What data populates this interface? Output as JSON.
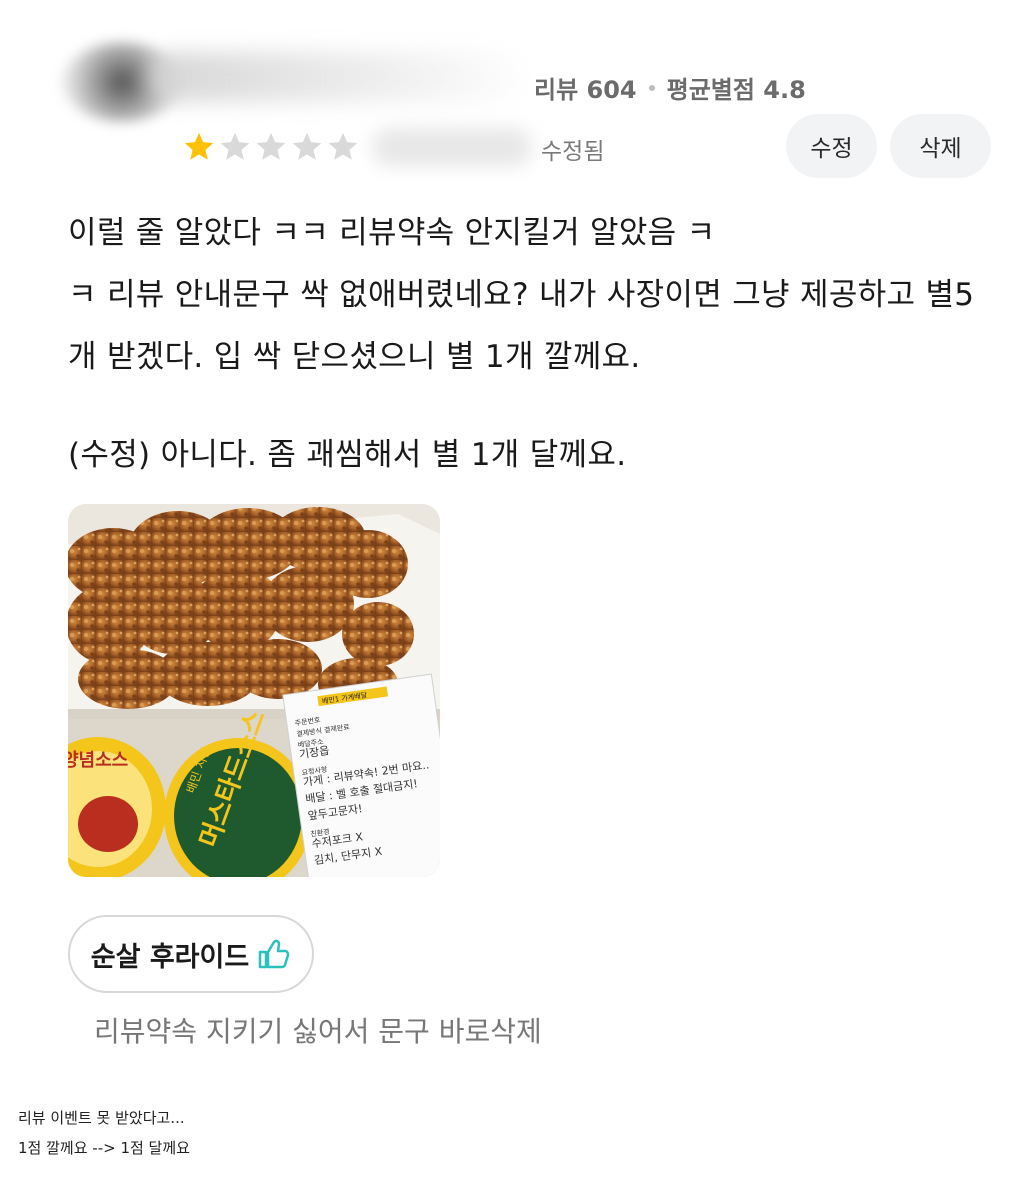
{
  "review": {
    "stats": {
      "review_count": "리뷰 604",
      "average_rating": "평균별점 4.8"
    },
    "rating": 1,
    "max_rating": 5,
    "edited_label": "수정됨",
    "actions": {
      "edit_label": "수정",
      "delete_label": "삭제"
    },
    "body_lines": [
      "이럴 줄 알았다 ㅋㅋ 리뷰약속 안지킬거 알았음 ㅋ",
      "ㅋ 리뷰 안내문구 싹 없애버렸네요? 내가 사장이면 그냥 제공하고 별5",
      "개 받겠다. 입 싹 닫으셨으니 별 1개 깔께요."
    ],
    "edit_note": "(수정) 아니다. 좀 괘씸해서 별 1개 달께요.",
    "photo_receipt": {
      "header": "배민1 가게배달",
      "lines": [
        "주문번호",
        "결제방식 결제완료",
        "배달주소",
        "기장읍",
        "요청사항",
        "가게 : 리뷰약속! 2번 마요..",
        "배달 : 벨 호출 절대금지!",
        "앞두고문자!",
        "친환경",
        "수저포크 X",
        "김치, 단무지 X"
      ]
    },
    "photo_sauce_label": "머스타드소스",
    "photo_sauce_brand": "배민 치킨",
    "photo_left_sauce": "양념소스",
    "menu_item": {
      "label": "순살 후라이드",
      "icon": "thumbs-up-icon"
    },
    "owner_note": "리뷰약속 지키기 싫어서 문구 바로삭제",
    "colors": {
      "star_filled": "#ffc107",
      "star_empty": "#d9d9d9",
      "thumb": "#2ac1bc"
    }
  },
  "captions": [
    "리뷰 이벤트 못 받았다고...",
    "1점 깔께요 --> 1점 달께요"
  ]
}
